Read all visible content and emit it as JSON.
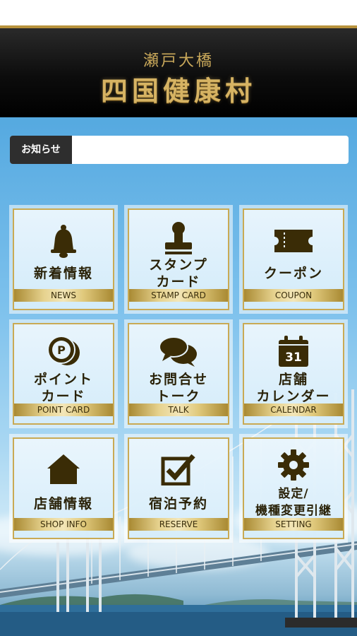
{
  "header": {
    "subtitle": "瀬戸大橋",
    "title": "四国健康村"
  },
  "notice": {
    "label": "お知らせ",
    "text": ""
  },
  "menu": [
    {
      "title_line1": "新着情報",
      "title_line2": "",
      "en": "NEWS",
      "icon": "bell-icon"
    },
    {
      "title_line1": "スタンプ",
      "title_line2": "カード",
      "en": "STAMP CARD",
      "icon": "stamp-icon"
    },
    {
      "title_line1": "クーポン",
      "title_line2": "",
      "en": "COUPON",
      "icon": "ticket-icon"
    },
    {
      "title_line1": "ポイント",
      "title_line2": "カード",
      "en": "POINT CARD",
      "icon": "coin-icon"
    },
    {
      "title_line1": "お問合せ",
      "title_line2": "トーク",
      "en": "TALK",
      "icon": "chat-bubbles-icon"
    },
    {
      "title_line1": "店舗",
      "title_line2": "カレンダー",
      "en": "CALENDAR",
      "icon": "calendar-icon"
    },
    {
      "title_line1": "店舗情報",
      "title_line2": "",
      "en": "SHOP INFO",
      "icon": "house-icon"
    },
    {
      "title_line1": "宿泊予約",
      "title_line2": "",
      "en": "RESERVE",
      "icon": "checkbox-icon"
    },
    {
      "title_line1": "設定/",
      "title_line2": "機種変更引継",
      "en": "SETTING",
      "icon": "gear-icon"
    }
  ],
  "calendar_day": "31",
  "point_symbol": "P",
  "colors": {
    "gold": "#c9aa54",
    "icon": "#3a2c06",
    "header_bg": "#0c0c0c"
  }
}
